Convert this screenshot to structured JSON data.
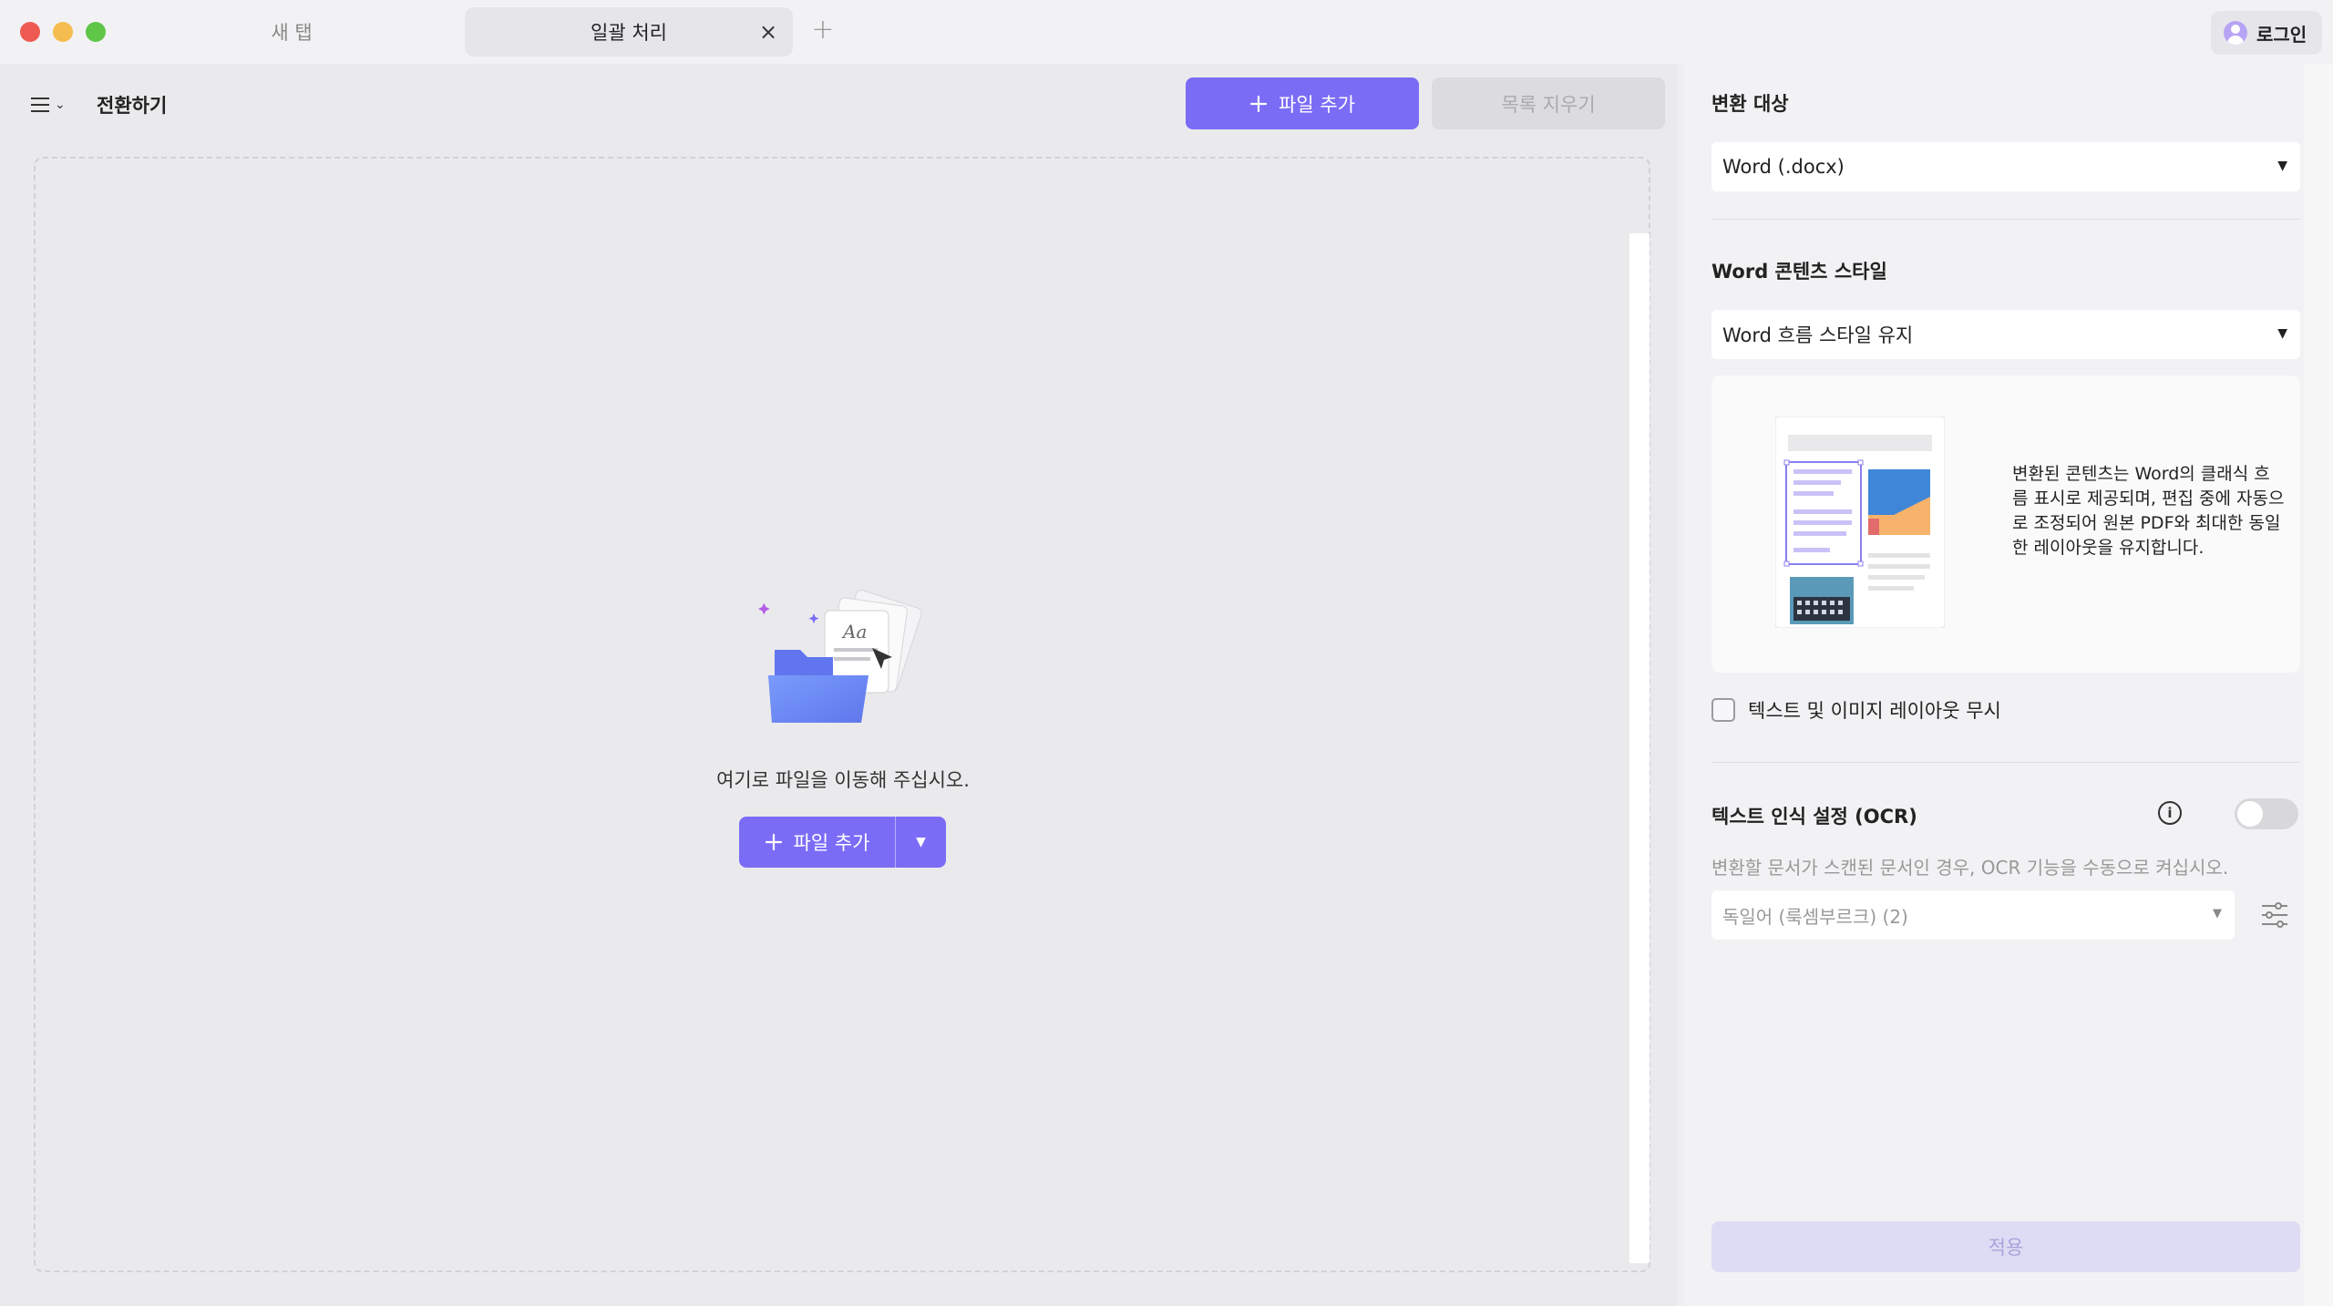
{
  "titlebar": {
    "tabs": [
      {
        "label": "새 탭",
        "active": false
      },
      {
        "label": "일괄 처리",
        "active": true
      }
    ],
    "login_label": "로그인"
  },
  "left": {
    "title": "전환하기",
    "add_file_label": "파일 추가",
    "clear_list_label": "목록 지우기",
    "drop_text": "여기로 파일을 이동해 주십시오.",
    "center_add_label": "파일 추가"
  },
  "right": {
    "target_label": "변환 대상",
    "target_value": "Word (.docx)",
    "style_label": "Word 콘텐츠 스타일",
    "style_value": "Word 흐름 스타일 유지",
    "preview_text": "변환된 콘텐츠는 Word의 클래식 흐름 표시로 제공되며, 편집 중에 자동으로 조정되어 원본 PDF와 최대한 동일한 레이아웃을 유지합니다.",
    "ignore_layout_label": "텍스트 및 이미지 레이아웃 무시",
    "ignore_layout_checked": false,
    "ocr_label": "텍스트 인식 설정 (OCR)",
    "ocr_enabled": false,
    "ocr_hint": "변환할 문서가 스캔된 문서인 경우, OCR 기능을 수동으로 켜십시오.",
    "ocr_language": "독일어 (룩셈부르크) (2)",
    "apply_label": "적용"
  },
  "colors": {
    "accent": "#7b6cf6",
    "disabled_accent": "#dedcf5",
    "close_red": "#ee5a52",
    "minimize_yellow": "#f5bd4f",
    "maximize_green": "#5fc648"
  }
}
